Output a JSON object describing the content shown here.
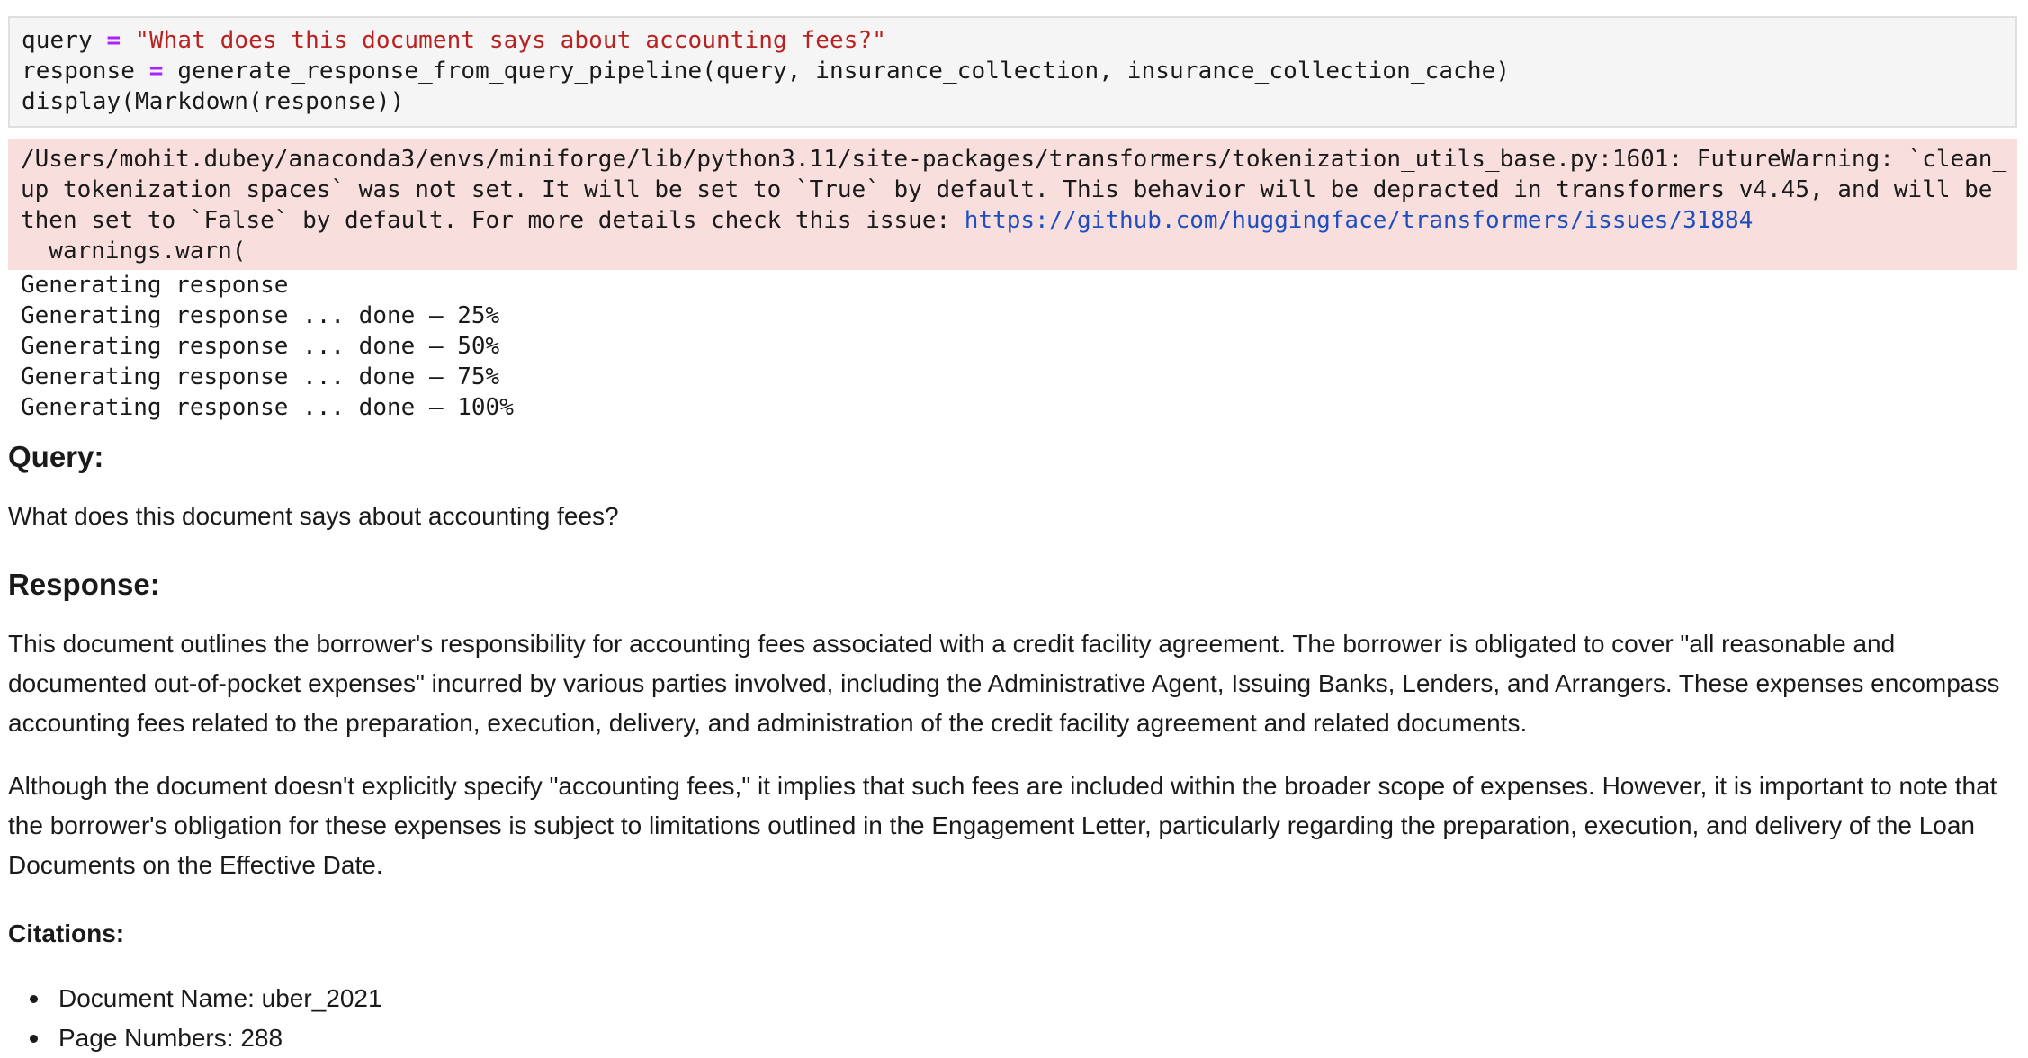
{
  "code_cell": {
    "line1": {
      "var": "query",
      "op": "=",
      "string": "\"What does this document says about accounting fees?\""
    },
    "line2": {
      "var": "response",
      "op": "=",
      "call": "generate_response_from_query_pipeline(query, insurance_collection, insurance_collection_cache)"
    },
    "line3": "display(Markdown(response))"
  },
  "stderr": {
    "line1": "/Users/mohit.dubey/anaconda3/envs/miniforge/lib/python3.11/site-packages/transformers/tokenization_utils_base.py:1601: FutureWarning: `clean_",
    "line2": "up_tokenization_spaces` was not set. It will be set to `True` by default. This behavior will be depracted in transformers v4.45, and will be",
    "line3_prefix": "then set to `False` by default. For more details check this issue: ",
    "link": "https://github.com/huggingface/transformers/issues/31884",
    "line4": "  warnings.warn("
  },
  "stdout": [
    "Generating response",
    "Generating response ... done – 25%",
    "Generating response ... done – 50%",
    "Generating response ... done – 75%",
    "Generating response ... done – 100%"
  ],
  "markdown": {
    "query_heading": "Query:",
    "query_text": "What does this document says about accounting fees?",
    "response_heading": "Response:",
    "para1": "This document outlines the borrower's responsibility for accounting fees associated with a credit facility agreement. The borrower is obligated to cover \"all reasonable and documented out-of-pocket expenses\" incurred by various parties involved, including the Administrative Agent, Issuing Banks, Lenders, and Arrangers. These expenses encompass accounting fees related to the preparation, execution, delivery, and administration of the credit facility agreement and related documents.",
    "para2": "Although the document doesn't explicitly specify \"accounting fees,\" it implies that such fees are included within the broader scope of expenses. However, it is important to note that the borrower's obligation for these expenses is subject to limitations outlined in the Engagement Letter, particularly regarding the preparation, execution, and delivery of the Loan Documents on the Effective Date.",
    "citations_heading": "Citations:",
    "citations": [
      "Document Name: uber_2021",
      "Page Numbers: 288"
    ]
  }
}
